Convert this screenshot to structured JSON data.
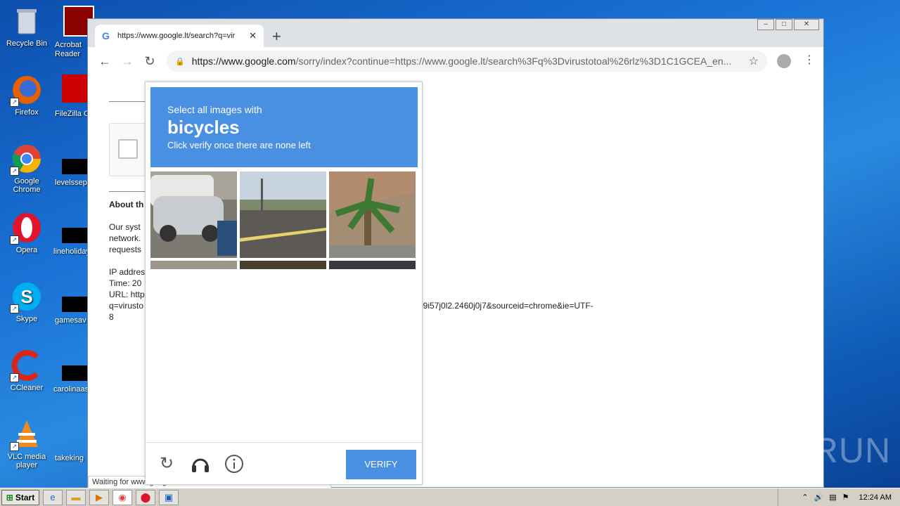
{
  "desktop": {
    "icons": [
      {
        "label": "Recycle Bin",
        "glyph": "🗑"
      },
      {
        "label": "Firefox",
        "glyph": "🦊"
      },
      {
        "label": "Google Chrome",
        "glyph": "◉"
      },
      {
        "label": "Opera",
        "glyph": "O"
      },
      {
        "label": "Skype",
        "glyph": "S"
      },
      {
        "label": "CCleaner",
        "glyph": "C"
      },
      {
        "label": "VLC media player",
        "glyph": "▲"
      }
    ],
    "col2": [
      {
        "label": "Acrobat Reader"
      },
      {
        "label": "FileZilla Cl"
      },
      {
        "label": "levelssep"
      },
      {
        "label": "lineholiday"
      },
      {
        "label": "gamesav"
      },
      {
        "label": "carolinaas"
      },
      {
        "label": "takeking"
      }
    ]
  },
  "browser": {
    "tab_title": "https://www.google.lt/search?q=vir",
    "url_domain": "https://www.google.com",
    "url_rest": "/sorry/index?continue=https://www.google.lt/search%3Fq%3Dvirustotoal%26rlz%3D1C1GCEA_en...",
    "status_text": "Waiting for www.google.com..."
  },
  "page": {
    "about_heading": "About th",
    "para1": "Our syst",
    "para2": "network.",
    "para3": "requests",
    "ip": "IP addres",
    "time": "Time: 20",
    "url": "URL: http",
    "q": "q=virusto",
    "url_tail": "59i57j0l2.2460j0j7&sourceid=chrome&ie=UTF-",
    "eight": "8"
  },
  "captcha": {
    "line1": "Select all images with",
    "keyword": "bicycles",
    "line3": "Click verify once there are none left",
    "verify_label": "VERIFY"
  },
  "taskbar": {
    "start_label": "Start",
    "clock": "12:24 AM"
  },
  "watermark": "ANY RUN"
}
